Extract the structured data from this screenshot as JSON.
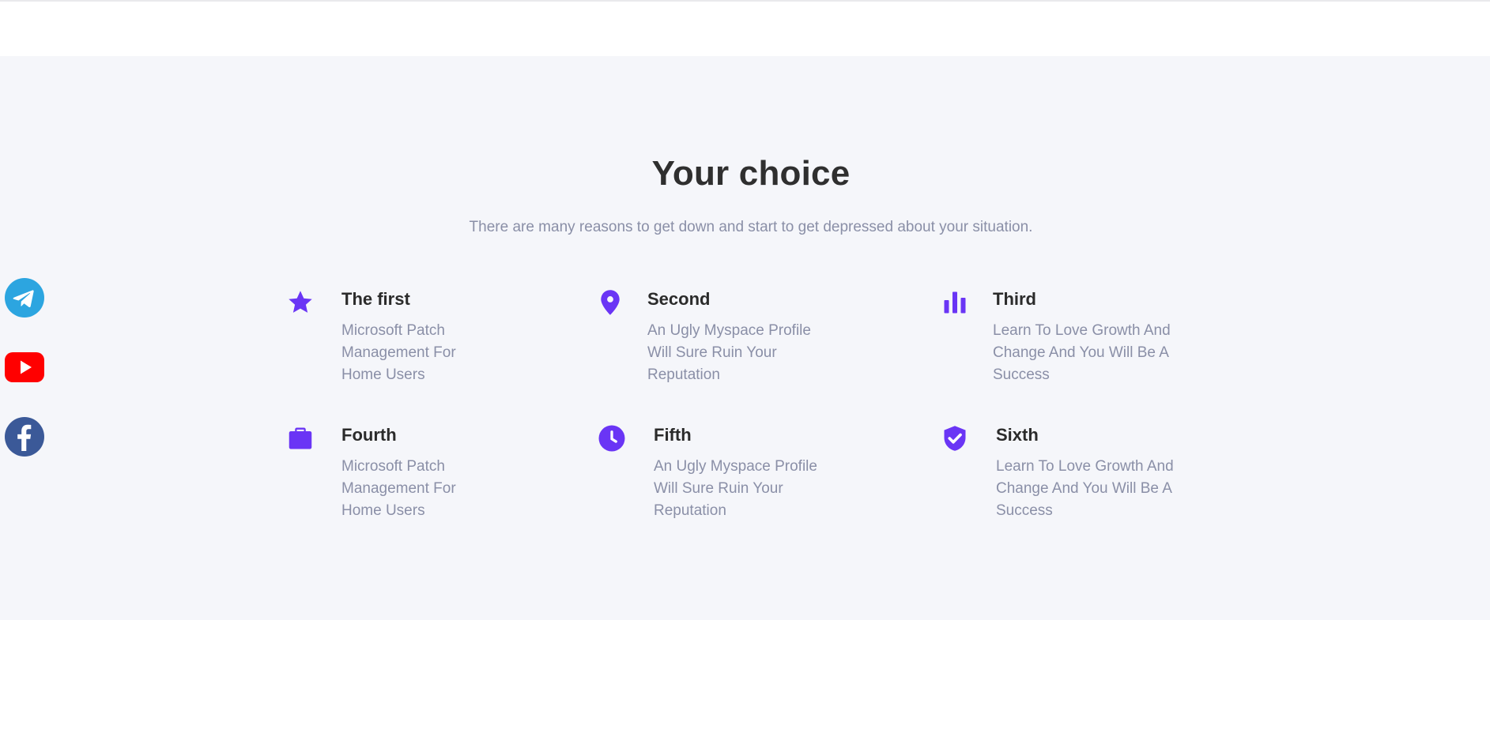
{
  "section": {
    "title": "Your choice",
    "subtitle": "There are many reasons to get down and start to get depressed about your situation."
  },
  "features": [
    {
      "icon": "star-icon",
      "title": "The first",
      "desc": "Microsoft Patch Management For Home Users"
    },
    {
      "icon": "map-pin-icon",
      "title": "Second",
      "desc": "An Ugly Myspace Profile Will Sure Ruin Your Reputation"
    },
    {
      "icon": "bar-chart-icon",
      "title": "Third",
      "desc": "Learn To Love Growth And Change And You Will Be A Success"
    },
    {
      "icon": "briefcase-icon",
      "title": "Fourth",
      "desc": "Microsoft Patch Management For Home Users"
    },
    {
      "icon": "clock-icon",
      "title": "Fifth",
      "desc": "An Ugly Myspace Profile Will Sure Ruin Your Reputation"
    },
    {
      "icon": "shield-check-icon",
      "title": "Sixth",
      "desc": "Learn To Love Growth And Change And You Will Be A Success"
    }
  ],
  "social": [
    {
      "icon": "telegram-icon",
      "color": "#2ca5e0"
    },
    {
      "icon": "youtube-icon",
      "color": "#ff0000"
    },
    {
      "icon": "facebook-icon",
      "color": "#3b5998"
    }
  ],
  "colors": {
    "accent": "#6a35f5",
    "section_bg": "#f5f6fa",
    "title": "#2f2f2f",
    "muted": "#8a8fa7"
  }
}
